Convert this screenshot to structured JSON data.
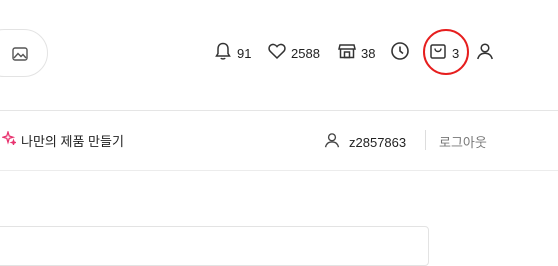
{
  "header": {
    "image_search": {
      "icon": "image-icon"
    },
    "icons": [
      {
        "name": "bell-icon",
        "count": "91"
      },
      {
        "name": "heart-icon",
        "count": "2588"
      },
      {
        "name": "store-icon",
        "count": "38"
      },
      {
        "name": "clock-icon"
      },
      {
        "name": "cart-icon",
        "count": "3"
      },
      {
        "name": "user-icon"
      }
    ],
    "highlight_color": "#e61e1e"
  },
  "subbar": {
    "make_product_label": "나만의 제품 만들기",
    "sparkle_color": "#e8336f",
    "user_id": "z2857863",
    "logout_label": "로그아웃"
  }
}
